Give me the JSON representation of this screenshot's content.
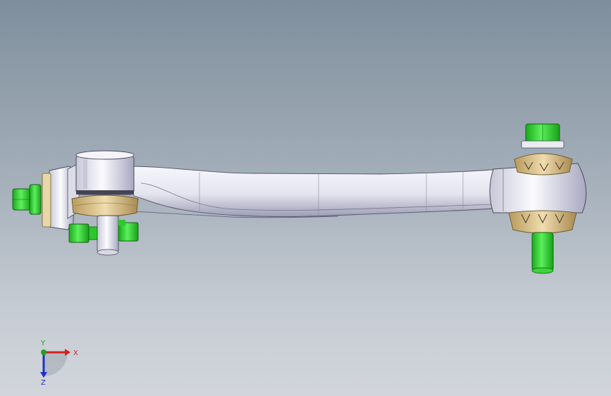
{
  "viewport": {
    "background_top": "#7e8e9c",
    "background_bottom": "#d2d6dc"
  },
  "model": {
    "arm_color": "#ececf4",
    "hardware_color": "#38d838",
    "bushing_color": "#d8c08a"
  },
  "triad": {
    "x_label": "X",
    "y_label": "Y",
    "z_label": "Z",
    "x_color": "#d42020",
    "y_color": "#20a020",
    "z_color": "#2030c8"
  }
}
